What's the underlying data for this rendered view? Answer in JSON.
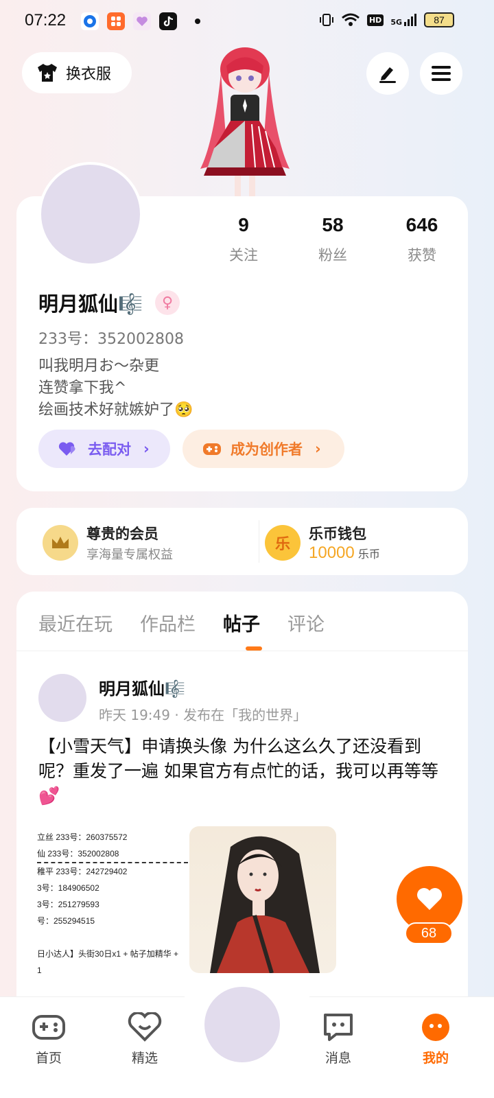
{
  "status": {
    "time": "07:22",
    "network": "HD",
    "signal": "5G",
    "battery": "87"
  },
  "header": {
    "outfit_label": "换衣服",
    "edit_icon": "pen-icon",
    "menu_icon": "menu-icon"
  },
  "profile": {
    "stats": [
      {
        "value": "9",
        "label": "关注"
      },
      {
        "value": "58",
        "label": "粉丝"
      },
      {
        "value": "646",
        "label": "获赞"
      }
    ],
    "name": "明月狐仙🎼",
    "uid": "233号：352002808",
    "bio": [
      "叫我明月お～杂更",
      "连赞拿下我^",
      "绘画技术好就嫉妒了🥺"
    ],
    "match_label": "去配对",
    "creator_label": "成为创作者"
  },
  "vip": {
    "member_title": "尊贵的会员",
    "member_sub": "享海量专属权益",
    "wallet_title": "乐币钱包",
    "wallet_amount": "10000",
    "wallet_unit": "乐币"
  },
  "tabs": [
    "最近在玩",
    "作品栏",
    "帖子",
    "评论"
  ],
  "active_tab": "帖子",
  "post": {
    "author": "明月狐仙🎼",
    "meta": "昨天 19:49 · 发布在「我的世界」",
    "text": "【小雪天气】申请换头像 为什么这么久了还没看到呢？重发了一遍 如果官方有点忙的话，我可以再等等💕",
    "image_lines": [
      "立丝 233号：260375572",
      "仙 233号：352002808",
      "",
      "稚平 233号：242729402",
      "3号：184906502",
      "3号：251279593",
      "号：255294515",
      "",
      "日小达人】头街30日x1 + 帖子加精华 +",
      "1"
    ],
    "likes": "68"
  },
  "nav": {
    "home": "首页",
    "featured": "精选",
    "messages": "消息",
    "mine": "我的"
  },
  "colors": {
    "accent": "#ff6a00",
    "match_bg": "#ece8fb",
    "match_fg": "#7a5cf0",
    "creator_bg": "#fdeee2",
    "creator_fg": "#f07a2a"
  }
}
